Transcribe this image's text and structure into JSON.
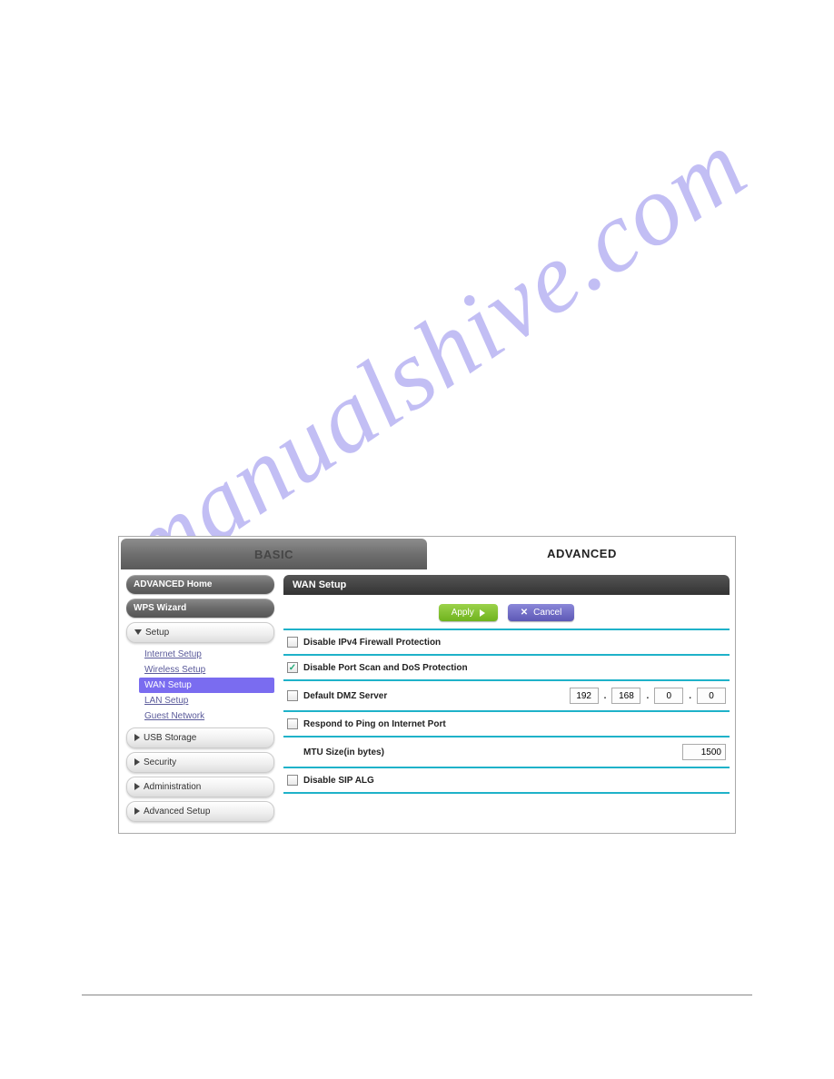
{
  "watermark": "manualshive.com",
  "tabs": {
    "basic": "BASIC",
    "advanced": "ADVANCED"
  },
  "sidebar": {
    "advanced_home": "ADVANCED Home",
    "wps_wizard": "WPS Wizard",
    "setup": "Setup",
    "items": [
      {
        "label": "Internet Setup"
      },
      {
        "label": "Wireless Setup"
      },
      {
        "label": "WAN Setup"
      },
      {
        "label": "LAN Setup"
      },
      {
        "label": "Guest Network"
      }
    ],
    "usb_storage": "USB Storage",
    "security": "Security",
    "administration": "Administration",
    "advanced_setup": "Advanced Setup"
  },
  "panel": {
    "title": "WAN Setup",
    "apply": "Apply",
    "cancel": "Cancel",
    "rows": {
      "disable_ipv4": "Disable IPv4 Firewall Protection",
      "disable_portscan": "Disable Port Scan and DoS Protection",
      "default_dmz": "Default DMZ Server",
      "respond_ping": "Respond to Ping on Internet Port",
      "mtu": "MTU Size(in bytes)",
      "disable_sip": "Disable SIP ALG"
    },
    "dmz_ip": [
      "192",
      "168",
      "0",
      "0"
    ],
    "mtu_value": "1500",
    "checked": {
      "disable_portscan": true
    }
  }
}
